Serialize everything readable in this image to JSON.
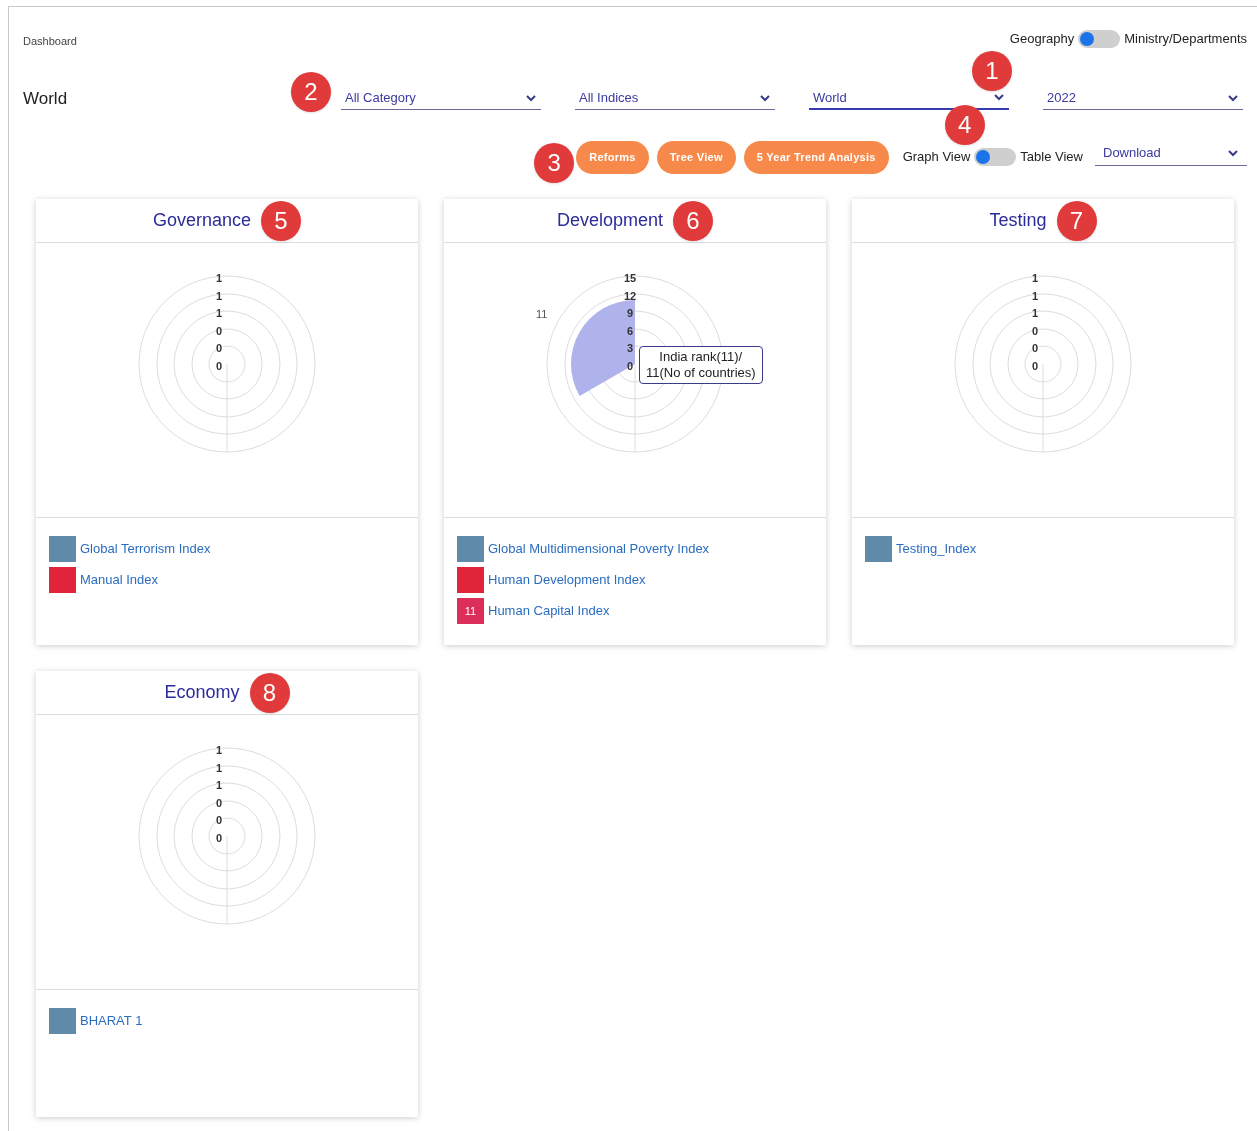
{
  "breadcrumb": "Dashboard",
  "view_toggle": {
    "left": "Geography",
    "right": "Ministry/Departments",
    "on": false,
    "marker": "1"
  },
  "title": "World",
  "filters_marker": "2",
  "filters": [
    {
      "value": "All Category",
      "selected": false
    },
    {
      "value": "All Indices",
      "selected": false
    },
    {
      "value": "World",
      "selected": true
    },
    {
      "value": "2022",
      "selected": false
    }
  ],
  "actions_marker": "3",
  "actions": [
    "Reforms",
    "Tree View",
    "5 Year Trend Analysis"
  ],
  "graph_toggle": {
    "left": "Graph View",
    "right": "Table View",
    "on": false,
    "marker": "4"
  },
  "download": {
    "value": "Download"
  },
  "cards": [
    {
      "title": "Governance",
      "marker": "5",
      "ticks": [
        "1",
        "1",
        "1",
        "0",
        "0",
        "0"
      ],
      "legend": [
        {
          "label": "Global Terrorism Index",
          "color": "#5f8aaa"
        },
        {
          "label": "Manual Index",
          "color": "#e0243a"
        }
      ]
    },
    {
      "title": "Development",
      "marker": "6",
      "ticks": [
        "15",
        "12",
        "9",
        "6",
        "3",
        "0"
      ],
      "sector": {
        "label": "11"
      },
      "tooltip": [
        "India rank(11)/",
        "11(No of countries)"
      ],
      "legend": [
        {
          "label": "Global Multidimensional Poverty Index",
          "color": "#5f8aaa"
        },
        {
          "label": "Human Development Index",
          "color": "#e0243a"
        },
        {
          "label": "Human Capital Index",
          "color": "#dc2e5a",
          "badge": "11"
        }
      ]
    },
    {
      "title": "Testing",
      "marker": "7",
      "ticks": [
        "1",
        "1",
        "1",
        "0",
        "0",
        "0"
      ],
      "legend": [
        {
          "label": "Testing_Index",
          "color": "#5f8aaa"
        }
      ]
    },
    {
      "title": "Economy",
      "marker": "8",
      "ticks": [
        "1",
        "1",
        "1",
        "0",
        "0",
        "0"
      ],
      "legend": [
        {
          "label": "BHARAT 1",
          "color": "#5f8aaa"
        }
      ]
    }
  ]
}
